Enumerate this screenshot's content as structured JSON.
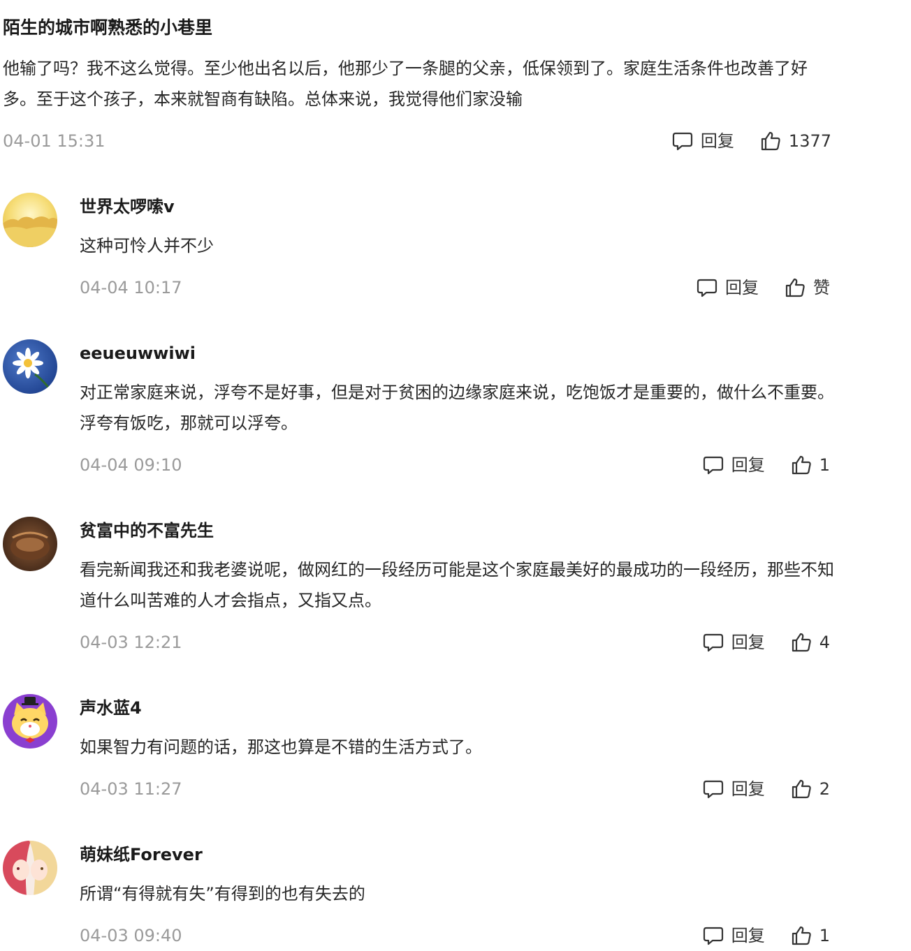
{
  "top_comment": {
    "author": "陌生的城市啊熟悉的小巷里",
    "content": "他输了吗？我不这么觉得。至少他出名以后，他那少了一条腿的父亲，低保领到了。家庭生活条件也改善了好多。至于这个孩子，本来就智商有缺陷。总体来说，我觉得他们家没输",
    "time": "04-01 15:31",
    "reply_label": "回复",
    "likes": "1377"
  },
  "replies": [
    {
      "author": "世界太啰嗦v",
      "content": "这种可怜人并不少",
      "time": "04-04 10:17",
      "reply_label": "回复",
      "likes": "赞",
      "avatar_icon": "sunset-dunes-avatar"
    },
    {
      "author": "eeueuwwiwi",
      "content": "对正常家庭来说，浮夸不是好事，但是对于贫困的边缘家庭来说，吃饱饭才是重要的，做什么不重要。浮夸有饭吃，那就可以浮夸。",
      "time": "04-04 09:10",
      "reply_label": "回复",
      "likes": "1",
      "avatar_icon": "daisy-avatar"
    },
    {
      "author": "贫富中的不富先生",
      "content": "看完新闻我还和我老婆说呢，做网红的一段经历可能是这个家庭最美好的最成功的一段经历，那些不知道什么叫苦难的人才会指点，又指又点。",
      "time": "04-03 12:21",
      "reply_label": "回复",
      "likes": "4",
      "avatar_icon": "brown-photo-avatar"
    },
    {
      "author": "声水蓝4",
      "content": "如果智力有问题的话，那这也算是不错的生活方式了。",
      "time": "04-03 11:27",
      "reply_label": "回复",
      "likes": "2",
      "avatar_icon": "cartoon-cat-avatar"
    },
    {
      "author": "萌妹纸Forever",
      "content": "所谓“有得就有失”有得到的也有失去的",
      "time": "04-03 09:40",
      "reply_label": "回复",
      "likes": "1",
      "avatar_icon": "anime-girls-avatar"
    }
  ],
  "colors": {
    "text": "#262626",
    "author": "#1a1a1a",
    "time": "#9a9a9a",
    "action": "#333333",
    "background": "#ffffff"
  },
  "icons": {
    "reply": "comment-bubble-icon",
    "like": "thumbs-up-icon"
  }
}
